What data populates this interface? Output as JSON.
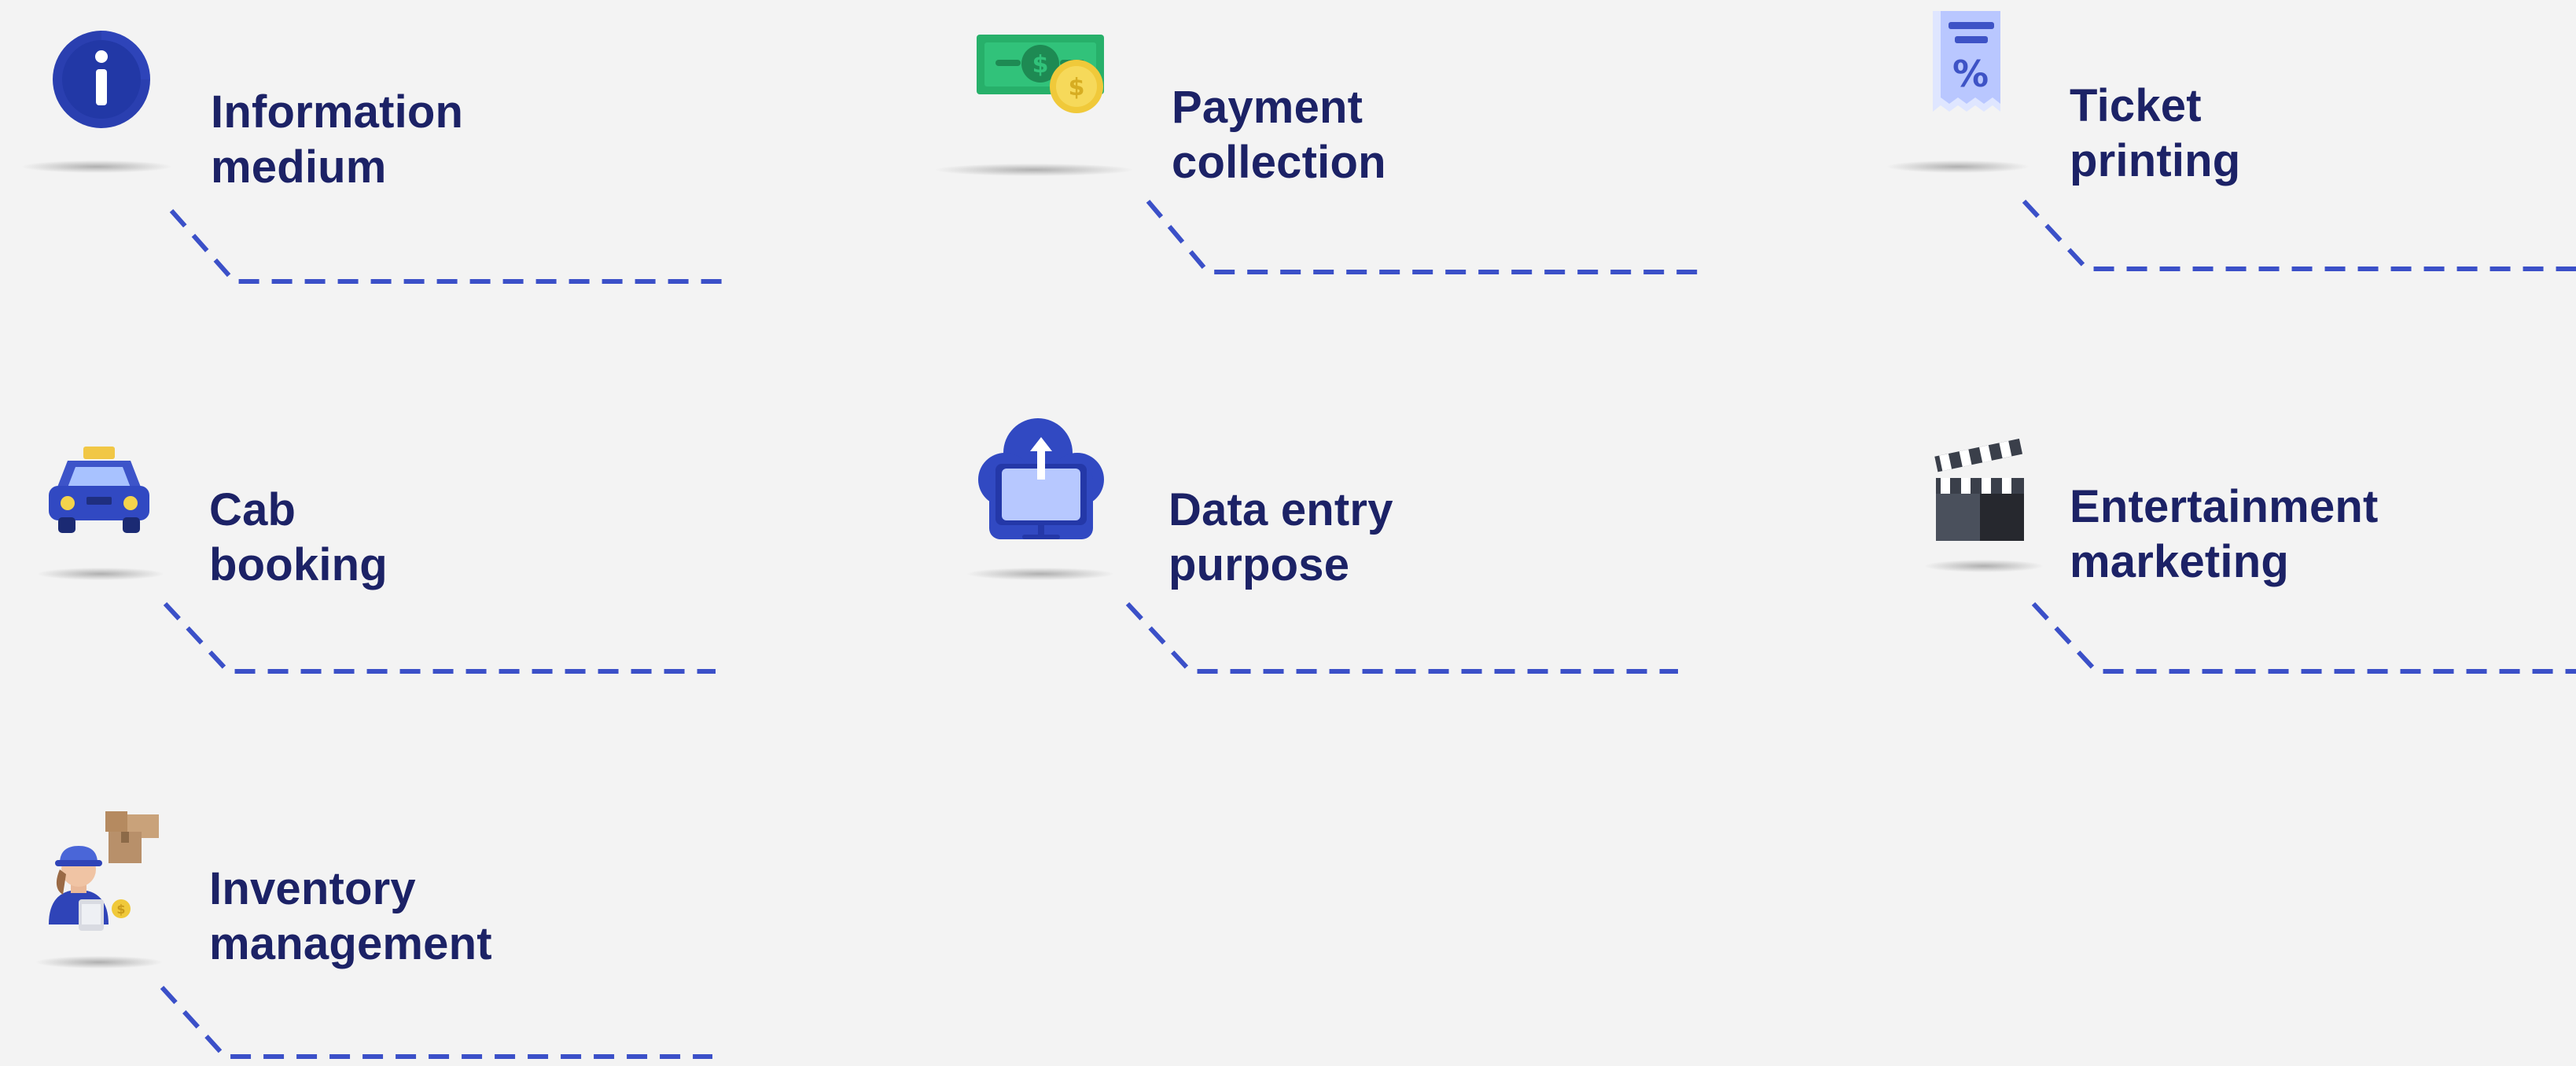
{
  "features": [
    {
      "id": "information-medium",
      "icon": "info-icon",
      "line1": "Information",
      "line2": "medium"
    },
    {
      "id": "payment-collection",
      "icon": "cash-icon",
      "line1": "Payment",
      "line2": "collection"
    },
    {
      "id": "ticket-printing",
      "icon": "receipt-icon",
      "line1": "Ticket",
      "line2": "printing"
    },
    {
      "id": "cab-booking",
      "icon": "taxi-icon",
      "line1": "Cab",
      "line2": "booking"
    },
    {
      "id": "data-entry-purpose",
      "icon": "cloud-upload-icon",
      "line1": "Data entry",
      "line2": "purpose"
    },
    {
      "id": "entertainment-marketing",
      "icon": "clapperboard-icon",
      "line1": "Entertainment",
      "line2": "marketing"
    },
    {
      "id": "inventory-management",
      "icon": "delivery-person-icon",
      "line1": "Inventory",
      "line2": "management"
    }
  ],
  "colors": {
    "background": "#f3f3f3",
    "label": "#1c2266",
    "connector": "#3b50c8",
    "icon_blue": "#2f44b8",
    "cash_green": "#27b06a",
    "coin_gold": "#f3cf45"
  }
}
